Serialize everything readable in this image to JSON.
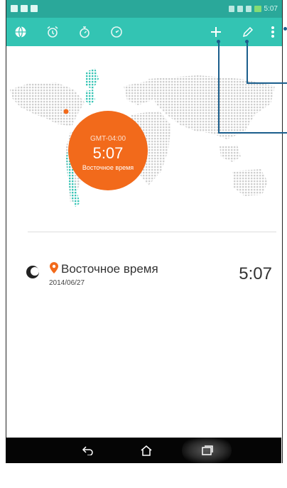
{
  "status_bar": {
    "time": "5:07"
  },
  "toolbar": {
    "items": [
      {
        "name": "world-clock",
        "icon": "globe-icon"
      },
      {
        "name": "alarm",
        "icon": "alarm-icon"
      },
      {
        "name": "stopwatch",
        "icon": "stopwatch-icon"
      },
      {
        "name": "timer",
        "icon": "timer-icon"
      },
      {
        "name": "add",
        "icon": "plus-icon"
      },
      {
        "name": "edit",
        "icon": "pencil-icon"
      },
      {
        "name": "menu",
        "icon": "more-vert-icon"
      }
    ]
  },
  "map_badge": {
    "gmt": "GMT-04:00",
    "time": "5:07",
    "zone": "Восточное время",
    "color": "#f26a1b"
  },
  "timezone_list": [
    {
      "name": "Восточное время",
      "date": "2014/06/27",
      "time": "5:07"
    }
  ],
  "colors": {
    "status_bar": "#2aa89a",
    "toolbar": "#33c4b3",
    "accent": "#f26a1b",
    "callout": "#1b5e8c"
  }
}
